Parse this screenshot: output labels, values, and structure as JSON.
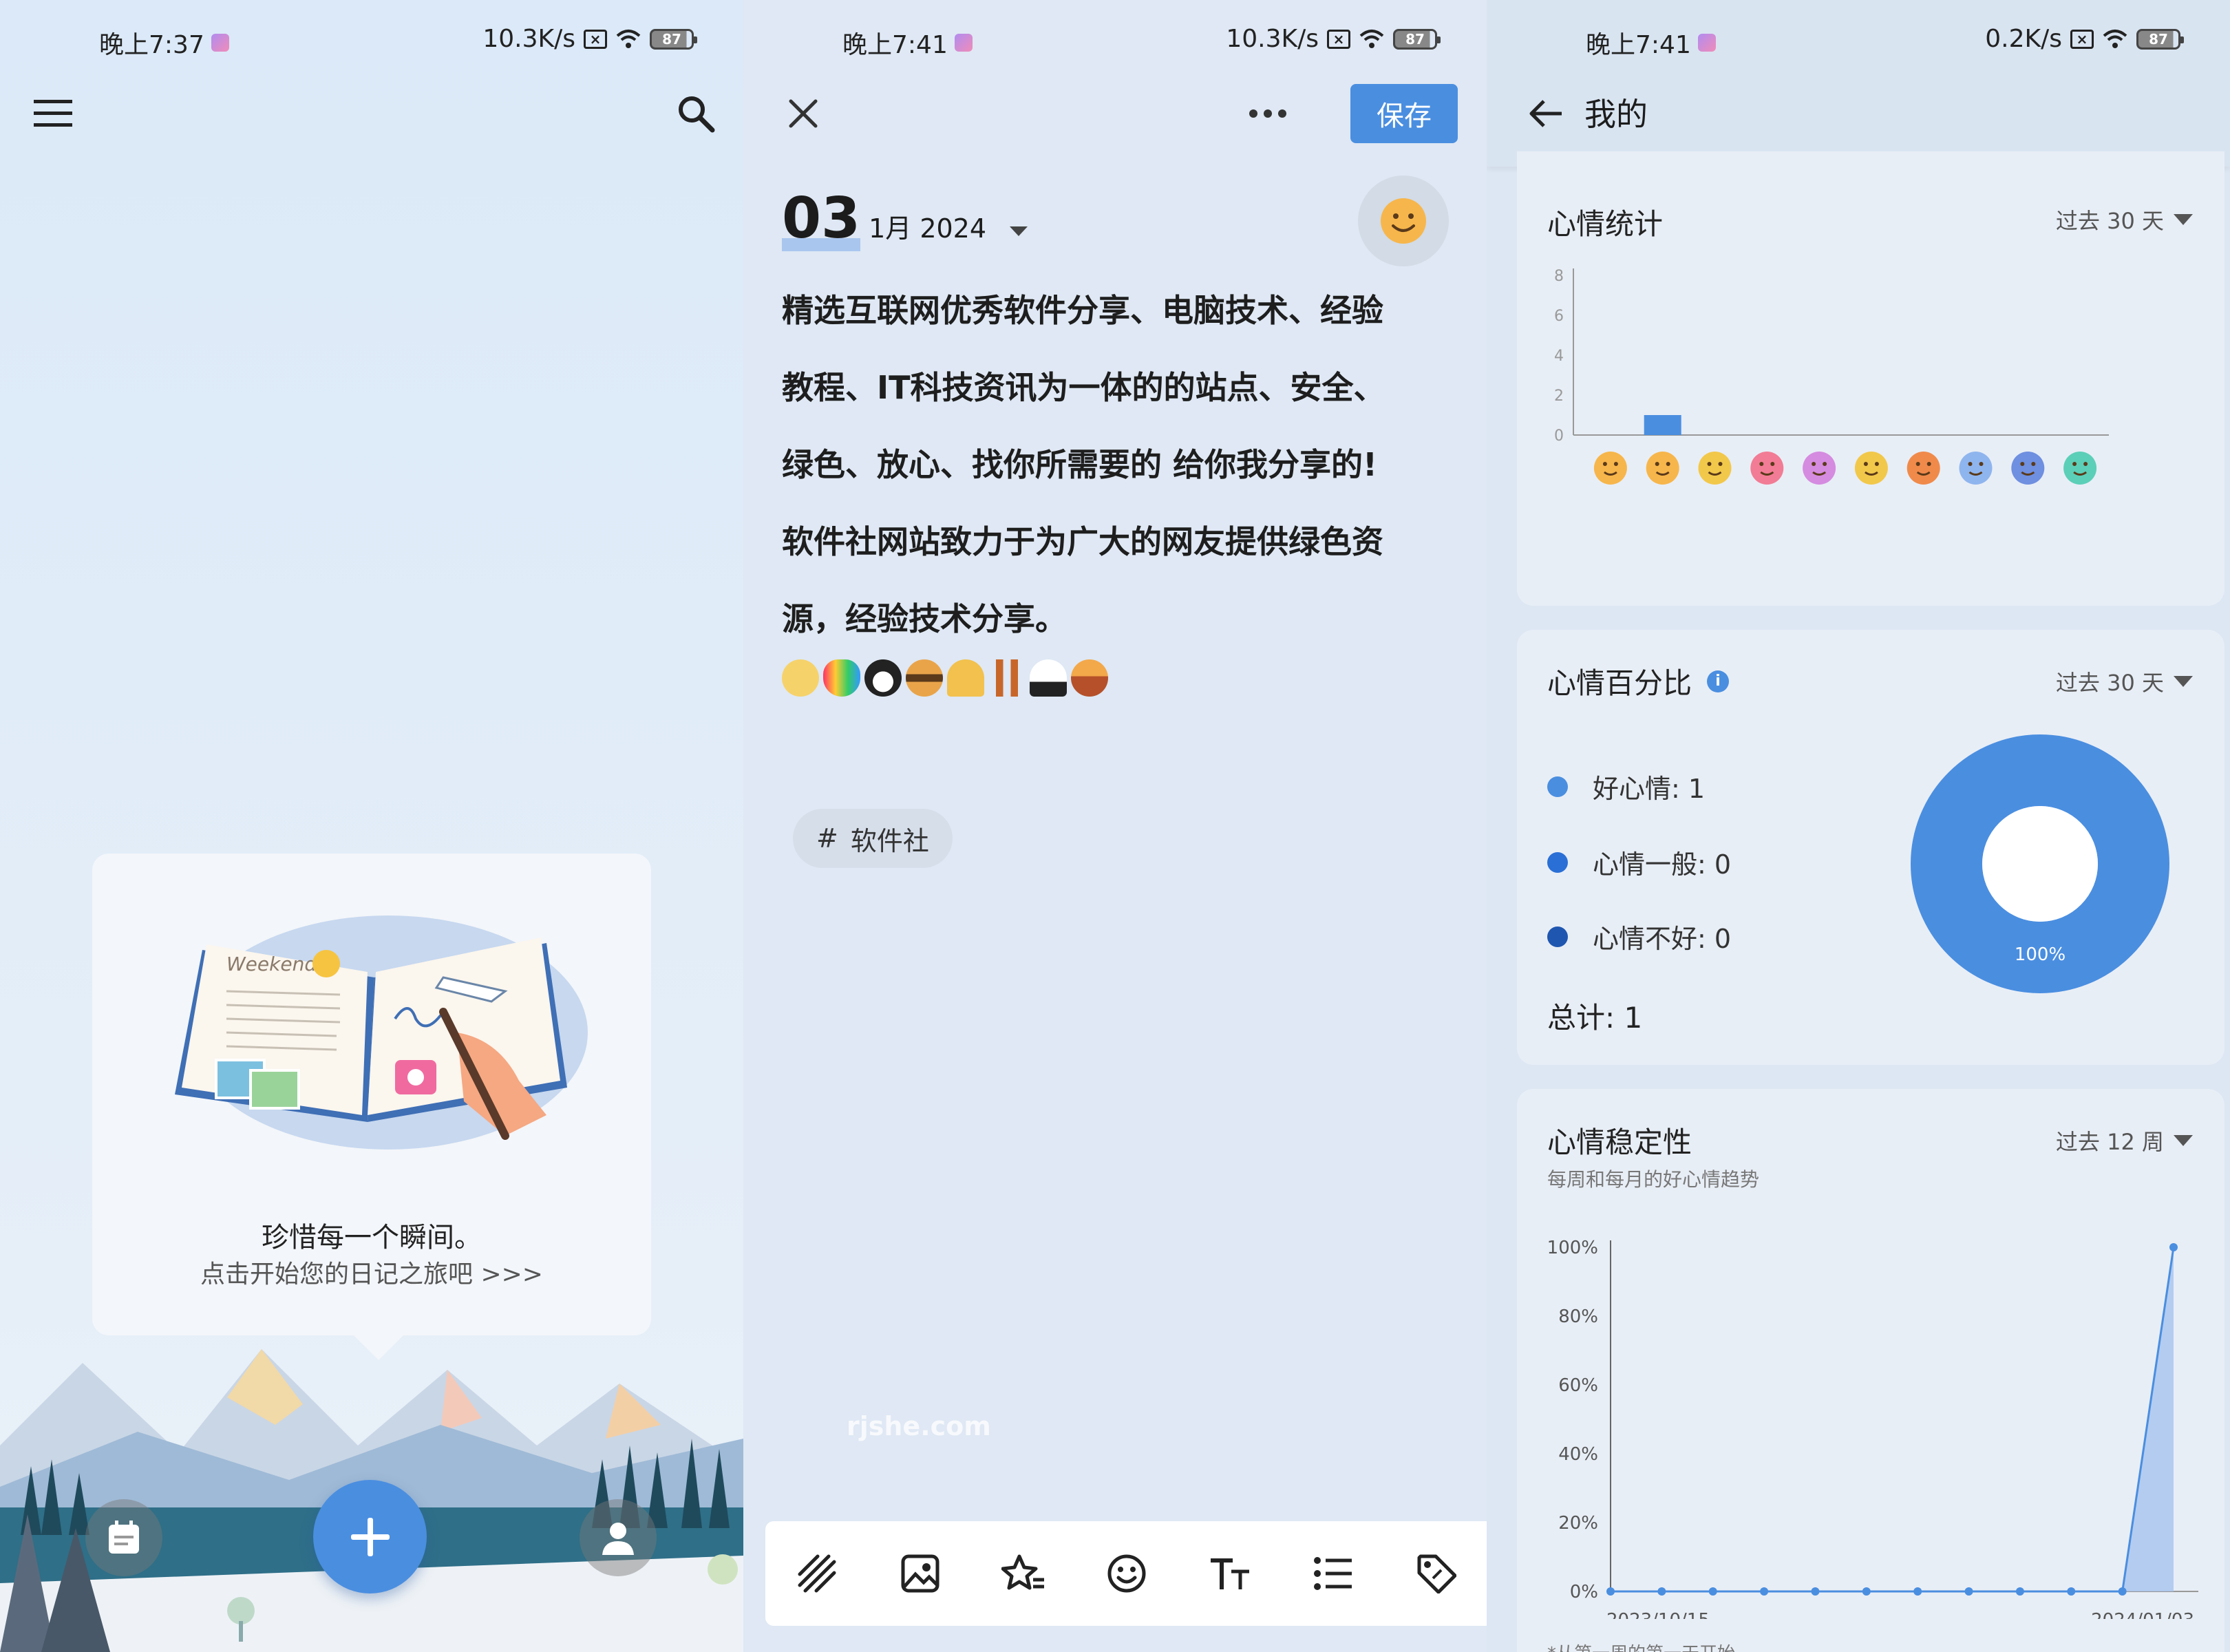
{
  "panel1": {
    "status": {
      "time": "晚上7:37",
      "speed": "10.3K/s",
      "battery": "87"
    },
    "empty_state": {
      "title": "珍惜每一个瞬间。",
      "subtitle": "点击开始您的日记之旅吧 >>>",
      "illustration_text": "Weekend"
    }
  },
  "panel2": {
    "status": {
      "time": "晚上7:41",
      "speed": "10.3K/s",
      "battery": "87"
    },
    "save_label": "保存",
    "date": {
      "day": "03",
      "month": "1月",
      "year": "2024"
    },
    "body_lines": [
      "精选互联网优秀软件分享、电脑技术、经验",
      "教程、IT科技资讯为一体的的站点、安全、",
      "绿色、放心、找你所需要的 给你我分享的!",
      "软件社网站致力于为广大的网友提供绿色资",
      "源，经验技术分享。"
    ],
    "tag": {
      "hash": "#",
      "label": "软件社"
    },
    "watermark": "rjshe.com"
  },
  "panel3": {
    "status": {
      "time": "晚上7:41",
      "speed": "0.2K/s",
      "battery": "87"
    },
    "title": "我的",
    "mood_stats": {
      "title": "心情统计",
      "range": "过去 30 天",
      "chart_data": {
        "type": "bar",
        "y_ticks": [
          "0",
          "2",
          "4",
          "6",
          "8"
        ],
        "ylim": [
          0,
          8
        ],
        "categories": [
          "neutral",
          "happy",
          "laugh",
          "love",
          "blush",
          "worried",
          "angry",
          "sad",
          "upset",
          "sick"
        ],
        "values": [
          0,
          1,
          0,
          0,
          0,
          0,
          0,
          0,
          0,
          0
        ],
        "colors": [
          "#f7b64b",
          "#f7b64b",
          "#f2c84b",
          "#f27c95",
          "#d58be0",
          "#f2c84b",
          "#f08a4b",
          "#8fb5ee",
          "#6f8fe0",
          "#5ccfb8"
        ]
      }
    },
    "mood_percent": {
      "title": "心情百分比",
      "info": "i",
      "range": "过去 30 天",
      "legend": [
        {
          "label": "好心情: 1",
          "color": "#4a8ee0"
        },
        {
          "label": "心情一般: 0",
          "color": "#2a6fd6"
        },
        {
          "label": "心情不好: 0",
          "color": "#1f56b0"
        }
      ],
      "total": "总计: 1",
      "chart_data": {
        "type": "pie",
        "labels": [
          "好心情",
          "心情一般",
          "心情不好"
        ],
        "values": [
          1,
          0,
          0
        ],
        "slice_label": "100%"
      }
    },
    "mood_stability": {
      "title": "心情稳定性",
      "subtitle": "每周和每月的好心情趋势",
      "range": "过去 12 周",
      "footnote": "*从第一周的第一天开始",
      "chart_data": {
        "type": "area",
        "y_ticks": [
          "0%",
          "20%",
          "40%",
          "60%",
          "80%",
          "100%"
        ],
        "ylim": [
          0,
          100
        ],
        "x_labels": [
          "2023/10/15",
          "2024/01/03"
        ],
        "values": [
          0,
          0,
          0,
          0,
          0,
          0,
          0,
          0,
          0,
          0,
          0,
          100
        ]
      }
    }
  }
}
